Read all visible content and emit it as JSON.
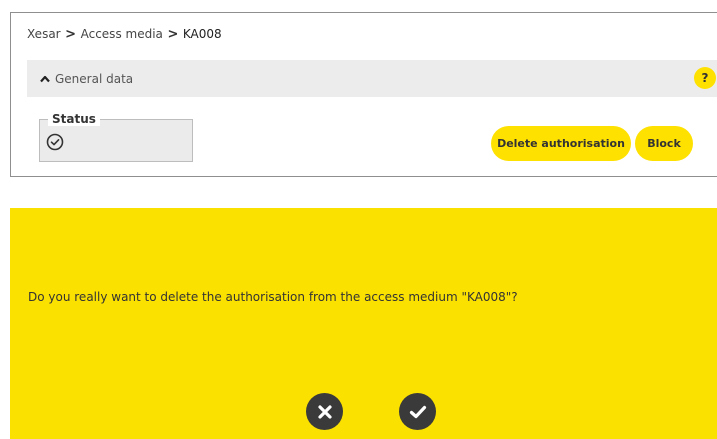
{
  "breadcrumb": {
    "items": [
      "Xesar",
      "Access media"
    ],
    "current": "KA008",
    "separator": ">"
  },
  "section": {
    "title": "General data",
    "help_label": "?"
  },
  "status": {
    "label": "Status",
    "icon": "check-circle-icon"
  },
  "actions": {
    "delete_label": "Delete authorisation",
    "block_label": "Block"
  },
  "dialog": {
    "message": "Do you really want to delete the authorisation from the access medium \"KA008\"?",
    "cancel_icon": "x-icon",
    "confirm_icon": "check-icon"
  },
  "colors": {
    "accent": "#ffe100",
    "dialog_background": "#fbe100",
    "dark_button": "#3a3a3a"
  }
}
